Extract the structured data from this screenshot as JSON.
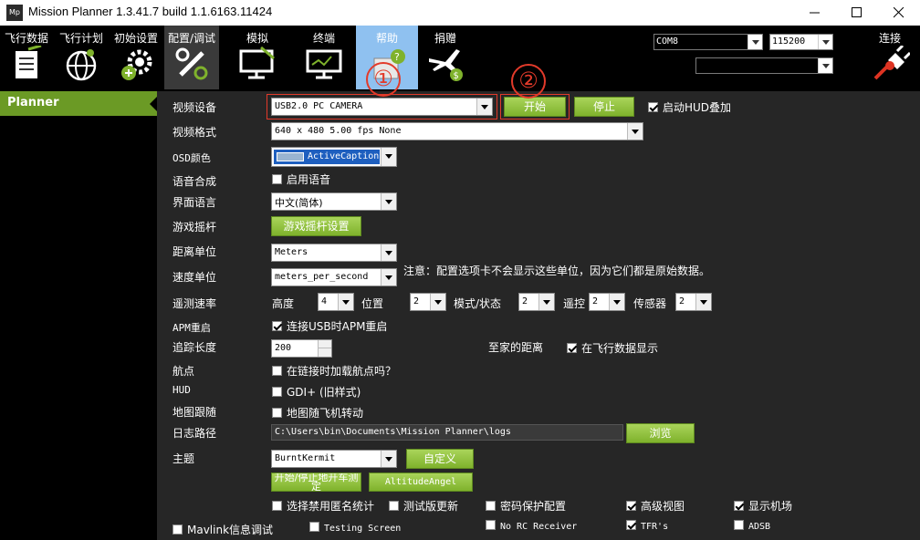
{
  "window": {
    "app_icon": "Mp",
    "title": "Mission Planner 1.3.41.7 build 1.1.6163.11424"
  },
  "toolbar": {
    "buttons": [
      {
        "label": "飞行数据",
        "icon": "flight-data-icon"
      },
      {
        "label": "飞行计划",
        "icon": "flight-plan-icon"
      },
      {
        "label": "初始设置",
        "icon": "initial-setup-icon"
      },
      {
        "label": "配置/调试",
        "icon": "config-tuning-icon"
      },
      {
        "label": "模拟",
        "icon": "simulation-icon"
      },
      {
        "label": "终端",
        "icon": "terminal-icon"
      },
      {
        "label": "帮助",
        "icon": "help-icon"
      },
      {
        "label": "捐赠",
        "icon": "donate-icon"
      }
    ],
    "port": "COM8",
    "baud": "115200",
    "link": "",
    "connect_label": "连接"
  },
  "sidebar": {
    "items": [
      {
        "label": "Planner"
      }
    ]
  },
  "planner": {
    "video_device": {
      "label": "视频设备",
      "value": "USB2.0 PC CAMERA"
    },
    "start_button": "开始",
    "stop_button": "停止",
    "hud_overlay": {
      "label": "启动HUD叠加",
      "checked": true
    },
    "video_format": {
      "label": "视频格式",
      "value": "640 x 480 5.00 fps None"
    },
    "osd_color": {
      "label": "OSD颜色",
      "value": "ActiveCaption",
      "swatch": "#99b4d1"
    },
    "speech": {
      "label": "语音合成",
      "checkbox": "启用语音",
      "checked": false
    },
    "language": {
      "label": "界面语言",
      "value": "中文(简体)"
    },
    "joystick": {
      "label": "游戏摇杆",
      "button": "游戏摇杆设置"
    },
    "distance_unit": {
      "label": "距离单位",
      "value": "Meters"
    },
    "speed_unit": {
      "label": "速度单位",
      "value": "meters_per_second",
      "note": "注意：配置选项卡不会显示这些单位，因为它们都是原始数据。"
    },
    "telemetry": {
      "label": "遥测速率",
      "altitude_label": "高度",
      "altitude": "4",
      "position_label": "位置",
      "position": "2",
      "mode_label": "模式/状态",
      "mode": "2",
      "rc_label": "遥控",
      "rc": "2",
      "sensor_label": "传感器",
      "sensor": "2"
    },
    "apm_reset": {
      "label": "APM重启",
      "checkbox": "连接USB时APM重启",
      "checked": true
    },
    "track_length": {
      "label": "追踪长度",
      "value": "200"
    },
    "home_distance": {
      "label": "至家的距离",
      "checkbox": "在飞行数据显示",
      "checked": true
    },
    "waypoints": {
      "label": "航点",
      "checkbox": "在链接时加载航点吗？",
      "checked": false
    },
    "hud": {
      "label": "HUD",
      "checkbox": "GDI+ (旧样式)",
      "checked": false
    },
    "map_follow": {
      "label": "地图跟随",
      "checkbox": "地图随飞机转动",
      "checked": false
    },
    "log_path": {
      "label": "日志路径",
      "value": "C:\\Users\\bin\\Documents\\Mission Planner\\logs",
      "browse_button": "浏览"
    },
    "theme": {
      "label": "主题",
      "value": "BurntKermit",
      "custom_button": "自定义"
    },
    "start_stop_button": "开始/停止地开车测定",
    "altitude_angel_button": "AltitudeAngel",
    "options": {
      "anon_stats": {
        "label": "选择禁用匿名统计",
        "checked": false
      },
      "beta_updates": {
        "label": "测试版更新",
        "checked": false
      },
      "password": {
        "label": "密码保护配置",
        "checked": false
      },
      "advanced_view": {
        "label": "高级视图",
        "checked": true
      },
      "show_airports": {
        "label": "显示机场",
        "checked": true
      },
      "mavlink_debug": {
        "label": "Mavlink信息调试",
        "checked": false
      },
      "testing_screen": {
        "label": "Testing Screen",
        "checked": false
      },
      "no_rc_receiver": {
        "label": "No RC Receiver",
        "checked": false
      },
      "tfrs": {
        "label": "TFR's",
        "checked": true
      },
      "adsb": {
        "label": "ADSB",
        "checked": false
      }
    }
  },
  "annotations": {
    "marker1": "①",
    "marker2": "②"
  },
  "colors": {
    "accent_green": "#7fb22c",
    "help_blue": "#8fc1f0",
    "annotation_red": "#e23a2a"
  }
}
